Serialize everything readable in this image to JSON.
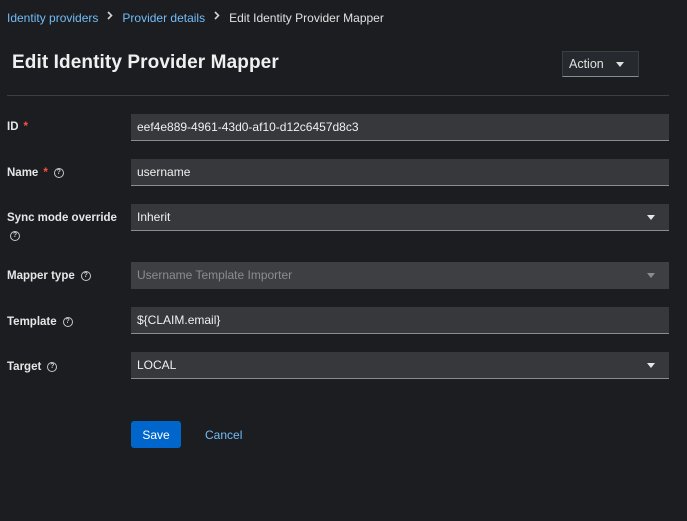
{
  "breadcrumb": {
    "items": [
      "Identity providers",
      "Provider details"
    ],
    "current": "Edit Identity Provider Mapper"
  },
  "header": {
    "title": "Edit Identity Provider Mapper",
    "action_label": "Action"
  },
  "form": {
    "id": {
      "label": "ID",
      "required": "*",
      "value": "eef4e889-4961-43d0-af10-d12c6457d8c3"
    },
    "name": {
      "label": "Name",
      "required": "*",
      "value": "username"
    },
    "sync_mode": {
      "label": "Sync mode override",
      "value": "Inherit"
    },
    "mapper_type": {
      "label": "Mapper type",
      "value": "Username Template Importer",
      "disabled": true
    },
    "template": {
      "label": "Template",
      "value": "${CLAIM.email}"
    },
    "target": {
      "label": "Target",
      "value": "LOCAL"
    }
  },
  "buttons": {
    "save": "Save",
    "cancel": "Cancel"
  },
  "icons": {
    "help": "?",
    "separator": "chevron-right-icon",
    "dropdown": "caret-down-icon"
  },
  "colors": {
    "background": "#1b1d21",
    "link": "#73bcf7",
    "primary": "#0066cc",
    "required": "#fe5142",
    "field_bg": "#36383c"
  }
}
